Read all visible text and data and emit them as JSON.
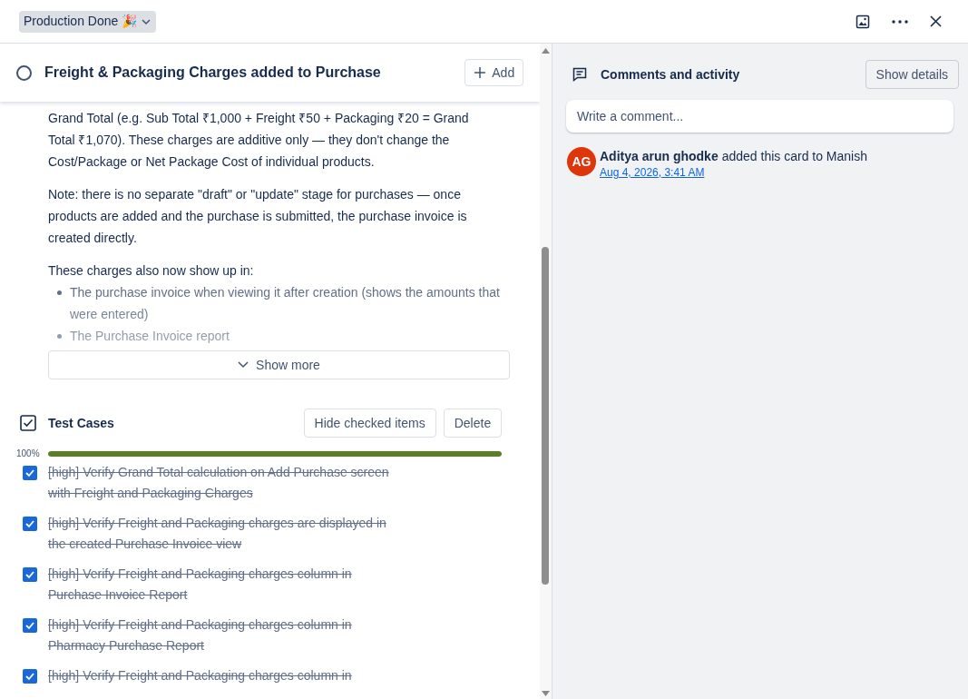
{
  "header": {
    "status": "Production Done 🎉"
  },
  "card": {
    "title": "Freight & Packaging Charges added to Purchase",
    "completed": false,
    "add_button": "Add"
  },
  "description": {
    "paragraphs": [
      "Grand Total (e.g. Sub Total ₹1,000 + Freight ₹50 + Packaging ₹20 = Grand Total ₹1,070). These charges are additive only — they don't change the Cost/Package or Net Package Cost of individual products.",
      "Note: there is no separate \"draft\" or \"update\" stage for purchases — once products are added and the purchase is submitted, the purchase invoice is created directly."
    ],
    "list_intro": "These charges also now show up in:",
    "list": [
      "The purchase invoice when viewing it after creation (shows the amounts that were entered)",
      "The Purchase Invoice report"
    ],
    "show_more": "Show more"
  },
  "checklist": {
    "title": "Test Cases",
    "hide_button": "Hide checked items",
    "delete_button": "Delete",
    "progress_label": "100%",
    "level": 1,
    "items": [
      {
        "text": "[high] Verify Grand Total calculation on Add Purchase screen with Freight and Packaging Charges",
        "checked": true
      },
      {
        "text": "[high] Verify Freight and Packaging charges are displayed in the created Purchase Invoice view",
        "checked": true
      },
      {
        "text": "[high] Verify Freight and Packaging charges column in Purchase Invoice Report",
        "checked": true
      },
      {
        "text": "[high] Verify Freight and Packaging charges column in Pharmacy Purchase Report",
        "checked": true
      },
      {
        "text": "[high] Verify Freight and Packaging charges column in",
        "checked": true
      }
    ]
  },
  "activity": {
    "title": "Comments and activity",
    "show_details": "Show details",
    "comment_placeholder": "Write a comment...",
    "entries": [
      {
        "initials": "AG",
        "author": "Aditya arun ghodke",
        "action": "added this card to Manish",
        "time": "Aug 4, 2026, 3:41 AM"
      }
    ]
  }
}
